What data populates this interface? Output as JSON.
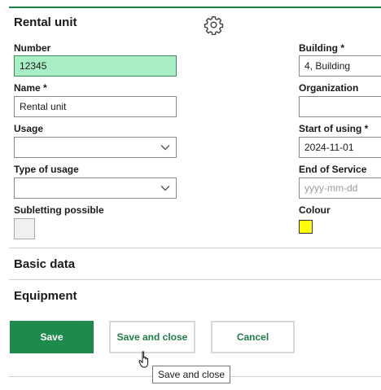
{
  "section": {
    "title": "Rental unit",
    "settings_icon": "gear-icon"
  },
  "fields": {
    "number": {
      "label": "Number",
      "value": "12345"
    },
    "name": {
      "label": "Name *",
      "value": "Rental unit"
    },
    "usage": {
      "label": "Usage",
      "value": ""
    },
    "type_of_usage": {
      "label": "Type of usage",
      "value": ""
    },
    "subletting": {
      "label": "Subletting possible",
      "checked": false
    },
    "building": {
      "label": "Building *",
      "value": "4, Building"
    },
    "organization": {
      "label": "Organization",
      "value": ""
    },
    "start_of_using": {
      "label": "Start of using *",
      "value": "2024-11-01"
    },
    "end_of_service": {
      "label": "End of Service",
      "value": "",
      "placeholder": "yyyy-mm-dd"
    },
    "colour": {
      "label": "Colour",
      "value": "#ffff00"
    }
  },
  "collapsed_sections": {
    "basic_data": "Basic data",
    "equipment": "Equipment"
  },
  "buttons": {
    "save": "Save",
    "save_and_close": "Save and close",
    "cancel": "Cancel"
  },
  "tooltip": {
    "text": "Save and close"
  },
  "colors": {
    "accent": "#1e8a4c",
    "focused_field": "#a8efc6",
    "colour_swatch": "#ffff00"
  }
}
